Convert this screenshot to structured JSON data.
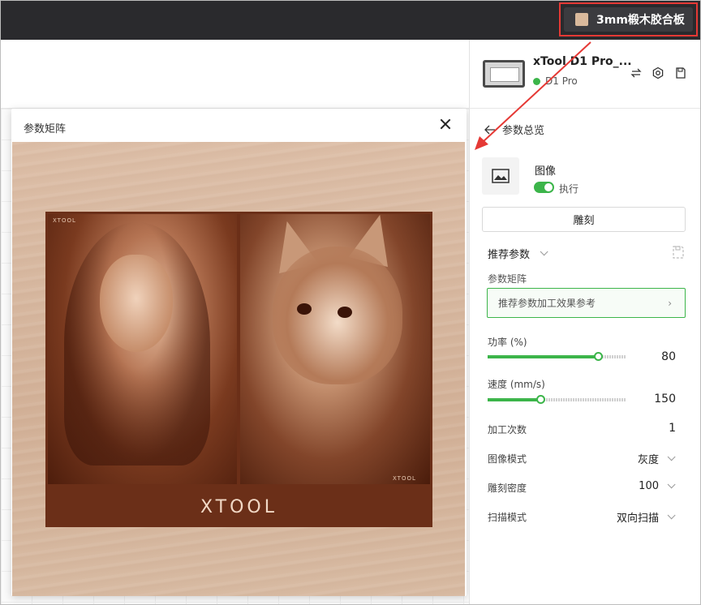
{
  "topbar": {
    "material_label": "3mm椴木胶合板",
    "material_color": "#d9b99c",
    "highlight_color": "#e53935"
  },
  "modal": {
    "title": "参数矩阵",
    "close_icon": "close-icon",
    "image": {
      "brand_text": "XTOOL",
      "corner_label_left": "XTOOL",
      "corner_label_right": "XTOOL"
    }
  },
  "device": {
    "name": "xTool D1 Pro_...",
    "status": "D1 Pro",
    "status_color": "#3cb54a",
    "icons": [
      "swap-icon",
      "settings-icon",
      "save-icon"
    ]
  },
  "panel": {
    "back_label": "参数总览",
    "layer_name": "图像",
    "toggle_label": "执行",
    "toggle_on": true,
    "mode_button": "雕刻",
    "recommended_label": "推荐参数",
    "matrix_label": "参数矩阵",
    "matrix_button": "推荐参数加工效果参考",
    "power": {
      "label": "功率 (%)",
      "value": "80",
      "fraction": 0.8
    },
    "speed": {
      "label": "速度 (mm/s)",
      "value": "150",
      "fraction": 0.38
    },
    "passes": {
      "label": "加工次数",
      "value": "1"
    },
    "image_mode": {
      "label": "图像模式",
      "value": "灰度"
    },
    "density": {
      "label": "雕刻密度",
      "value": "100"
    },
    "scan_mode": {
      "label": "扫描模式",
      "value": "双向扫描"
    }
  },
  "accent_color": "#3cb54a"
}
